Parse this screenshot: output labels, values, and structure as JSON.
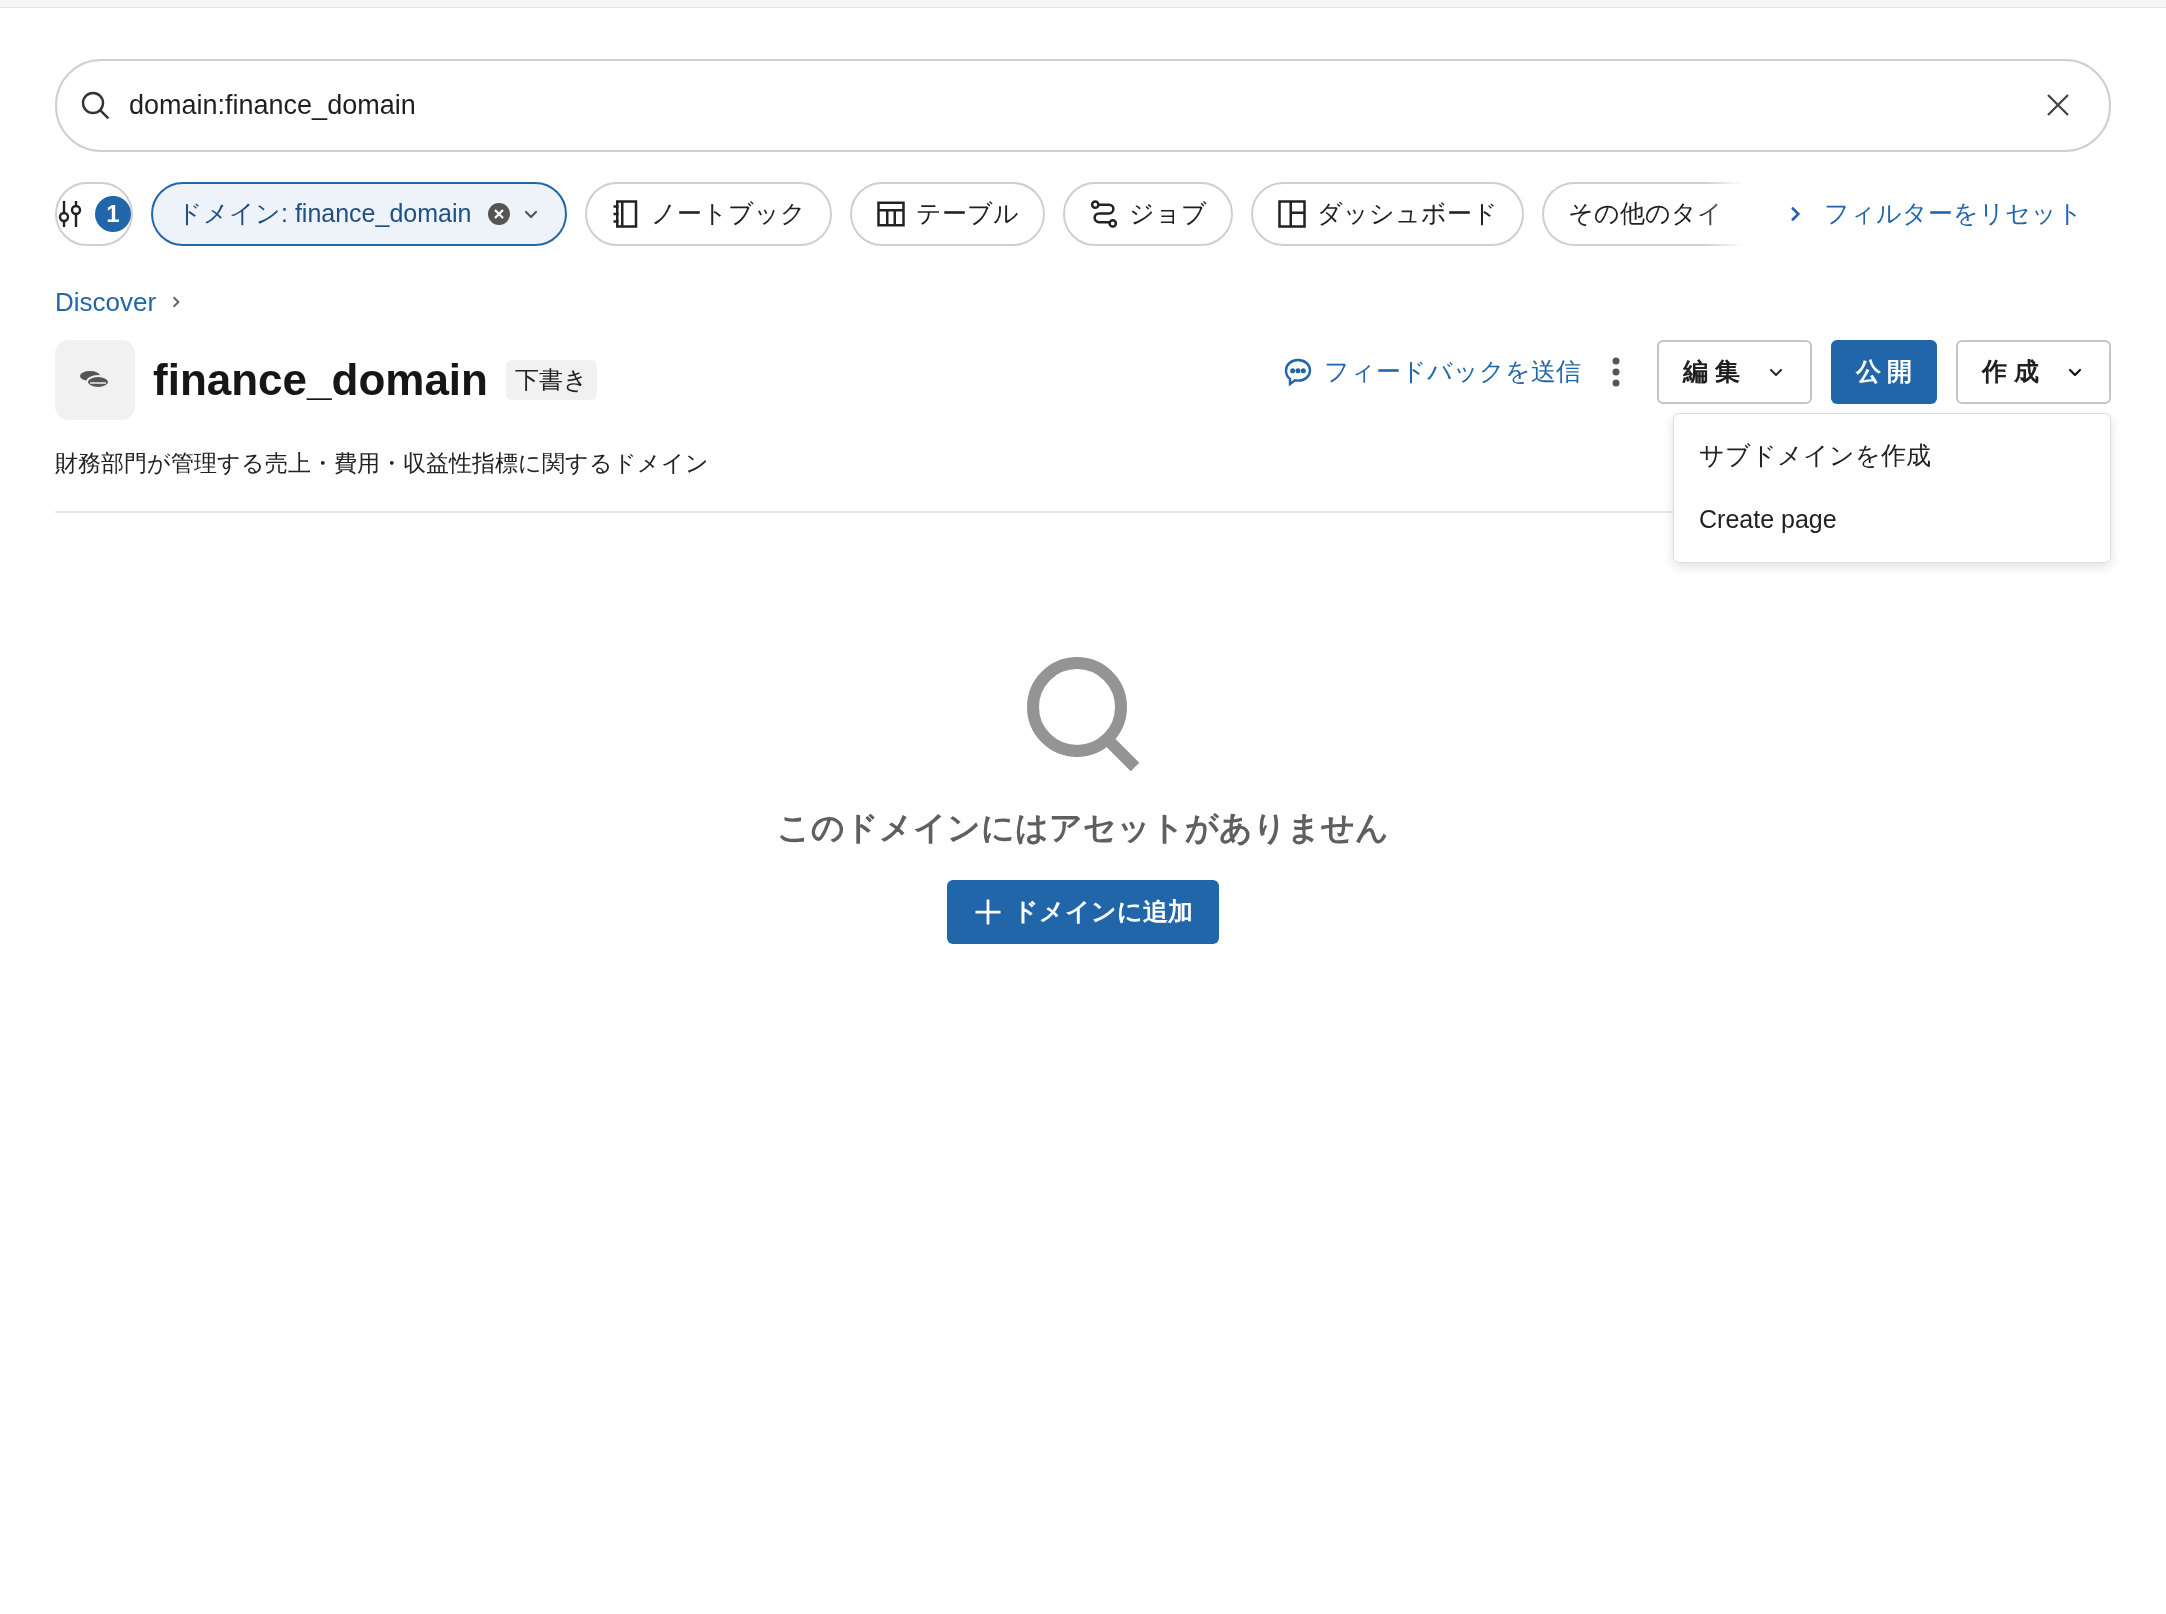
{
  "search": {
    "value": "domain:finance_domain"
  },
  "filters": {
    "count_badge": "1",
    "chips": [
      {
        "kind": "domain",
        "label": "ドメイン: finance_domain",
        "active": true
      },
      {
        "kind": "notebook",
        "label": "ノートブック",
        "active": false
      },
      {
        "kind": "table",
        "label": "テーブル",
        "active": false
      },
      {
        "kind": "job",
        "label": "ジョブ",
        "active": false
      },
      {
        "kind": "dashboard",
        "label": "ダッシュボード",
        "active": false
      },
      {
        "kind": "more",
        "label": "その他のタイ",
        "active": false
      }
    ],
    "reset_link": "フィルターをリセット"
  },
  "breadcrumb": [
    "Discover"
  ],
  "header": {
    "title": "finance_domain",
    "badge": "下書き",
    "description": "財務部門が管理する売上・費用・収益性指標に関するドメイン",
    "feedback_link": "フィードバックを送信",
    "buttons": [
      {
        "kind": "dropdown",
        "label": "編 集",
        "expanded": false
      },
      {
        "kind": "primary",
        "label": "公 開"
      },
      {
        "kind": "dropdown",
        "label": "作 成",
        "expanded": true,
        "menu": [
          "サブドメインを作成",
          "Create page"
        ]
      }
    ]
  },
  "empty_state": {
    "message": "このドメインにはアセットがありません",
    "button": "ドメインに追加"
  }
}
